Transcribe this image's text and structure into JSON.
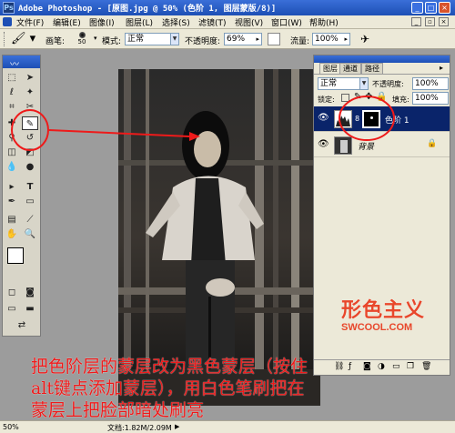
{
  "titlebar": {
    "title": "Adobe Photoshop - [原图.jpg @ 50% (色阶 1, 图层蒙版/8)]",
    "app_icon": "Ps",
    "buttons": [
      "_",
      "□",
      "×"
    ]
  },
  "menubar": {
    "items": [
      "文件(F)",
      "编辑(E)",
      "图像(I)",
      "图层(L)",
      "选择(S)",
      "滤镜(T)",
      "视图(V)",
      "窗口(W)",
      "帮助(H)"
    ]
  },
  "options": {
    "brush_label": "画笔:",
    "brush_size": "50",
    "mode_label": "模式:",
    "mode_value": "正常",
    "opacity_label": "不透明度:",
    "opacity_value": "69%",
    "flow_label": "流量:",
    "flow_value": "100%"
  },
  "layers_panel": {
    "tabs": [
      "图层",
      "通道",
      "路径"
    ],
    "blend_mode": "正常",
    "opacity_label": "不透明度:",
    "opacity_value": "100%",
    "lock_label": "锁定:",
    "fill_label": "填充:",
    "fill_value": "100%",
    "layers": [
      {
        "name": "色阶 1"
      },
      {
        "name": "背景"
      }
    ]
  },
  "watermark": {
    "logo_text": "形色主义",
    "site": "SWCOOL.COM"
  },
  "annotation": {
    "line1": "把色阶层的蒙层改为黑色蒙层（按住",
    "line2": "alt键点添加蒙层），用白色笔刷把在",
    "line3": "蒙层上把脸部暗处刷亮"
  },
  "status": {
    "zoom": "50%",
    "doc_info": "文档:1.82M/2.09M"
  },
  "colors": {
    "title_bar": "#2458c8",
    "annotation_red": "#ee1a1a",
    "highlight_blue": "#0a246a"
  }
}
